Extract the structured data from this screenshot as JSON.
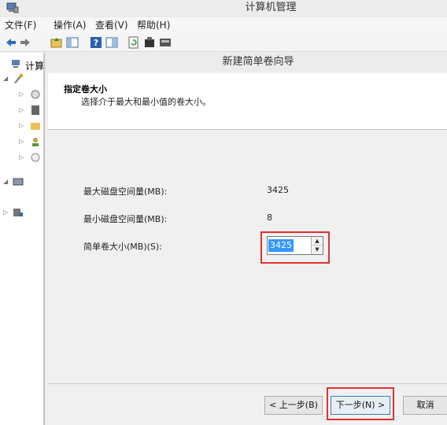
{
  "window": {
    "title": "计算机管理"
  },
  "menu": [
    "文件(F)",
    "操作(A)",
    "查看(V)",
    "帮助(H)"
  ],
  "tree": {
    "root_label": "计算"
  },
  "wizard": {
    "title": "新建简单卷向导",
    "header_title": "指定卷大小",
    "header_subtitle": "选择介于最大和最小值的卷大小。",
    "fields": [
      {
        "label": "最大磁盘空间量(MB):",
        "value": "3425"
      },
      {
        "label": "最小磁盘空间量(MB):",
        "value": "8"
      }
    ],
    "size_label": "简单卷大小(MB)(S):",
    "size_value": "3425",
    "back_button": "< 上一步(B)",
    "next_button": "下一步(N) >",
    "cancel_button": "取消"
  },
  "colors": {
    "highlight_box": "#e03030",
    "selection": "#3399ff"
  }
}
